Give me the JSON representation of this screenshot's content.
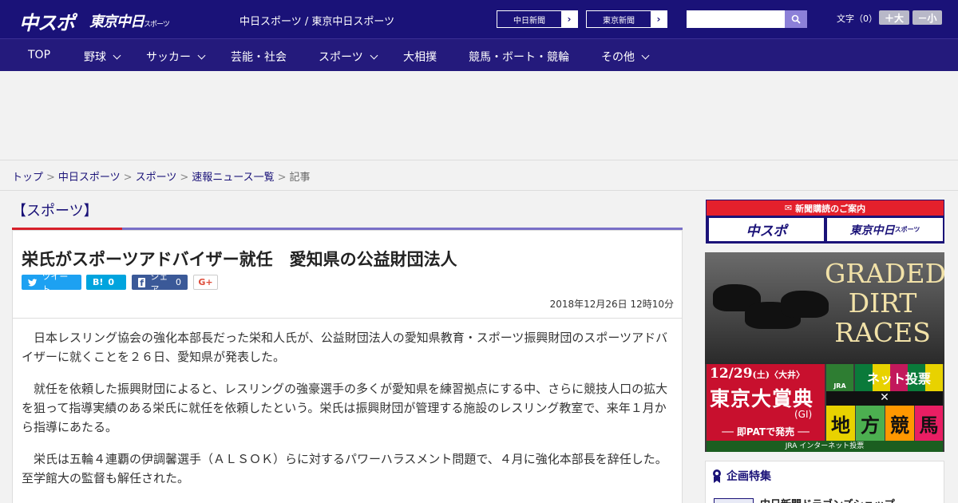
{
  "header": {
    "logo_main": "中スポ",
    "logo_tokyo": "東京中日",
    "logo_tokyo_sub": "スポーツ",
    "site_title": "中日スポーツ / 東京中日スポーツ",
    "btn_chunichi": "中日新聞",
    "btn_tokyo": "東京新聞",
    "search_placeholder": "",
    "font_size_label": "文字（0）",
    "font_plus": "＋大",
    "font_minus": "－小"
  },
  "nav": {
    "items": [
      {
        "label": "TOP",
        "dropdown": false
      },
      {
        "label": "野球",
        "dropdown": true
      },
      {
        "label": "サッカー",
        "dropdown": true
      },
      {
        "label": "芸能・社会",
        "dropdown": false
      },
      {
        "label": "スポーツ",
        "dropdown": true
      },
      {
        "label": "大相撲",
        "dropdown": false
      },
      {
        "label": "競馬・ボート・競輪",
        "dropdown": false
      },
      {
        "label": "その他",
        "dropdown": true
      }
    ]
  },
  "breadcrumb": {
    "items": [
      "トップ",
      "中日スポーツ",
      "スポーツ",
      "速報ニュース一覧"
    ],
    "current": "記事"
  },
  "article": {
    "category": "【スポーツ】",
    "headline": "栄氏がスポーツアドバイザー就任　愛知県の公益財団法人",
    "share_tweet": "ツイート",
    "share_hatena": "B!",
    "share_hatena_count": "0",
    "share_facebook": "シェア",
    "share_facebook_count": "0",
    "share_gplus": "G+",
    "date": "2018年12月26日 12時10分",
    "paragraphs": [
      "日本レスリング協会の強化本部長だった栄和人氏が、公益財団法人の愛知県教育・スポーツ振興財団のスポーツアドバイザーに就くことを２６日、愛知県が発表した。",
      "就任を依頼した振興財団によると、レスリングの強豪選手の多くが愛知県を練習拠点にする中、さらに競技人口の拡大を狙って指導実績のある栄氏に就任を依頼したという。栄氏は振興財団が管理する施設のレスリング教室で、来年１月から指導にあたる。",
      "栄氏は五輪４連覇の伊調馨選手（ＡＬＳＯＫ）らに対するパワーハラスメント問題で、４月に強化本部長を辞任した。至学館大の監督も解任された。"
    ]
  },
  "sidebar": {
    "subscribe_title": "新聞購読のご案内",
    "subscribe_chuspo": "中スポ",
    "subscribe_tokyo": "東京中日",
    "subscribe_tokyo_sub": "スポーツ",
    "race_ad": {
      "graded_line1": "GRADED",
      "graded_line2": "DIRT",
      "graded_line3": "RACES",
      "date": "12/29",
      "date_detail": "(土)〈大井〉",
      "title": "東京大賞典",
      "grade": "(GI)",
      "pat": "── 即PATで発売 ──",
      "net": "ネット投票",
      "chiho": [
        "地",
        "方",
        "競",
        "馬"
      ],
      "jra_footer": "JRA インターネット投票",
      "jra_logo": "JRA"
    },
    "kikaku_title": "企画特集",
    "kikaku_item": "中日新聞ドラゴンズショップ"
  },
  "colors": {
    "header_bg": "#1a1278",
    "nav_bg": "#241a7c",
    "accent_red": "#d8202a"
  }
}
